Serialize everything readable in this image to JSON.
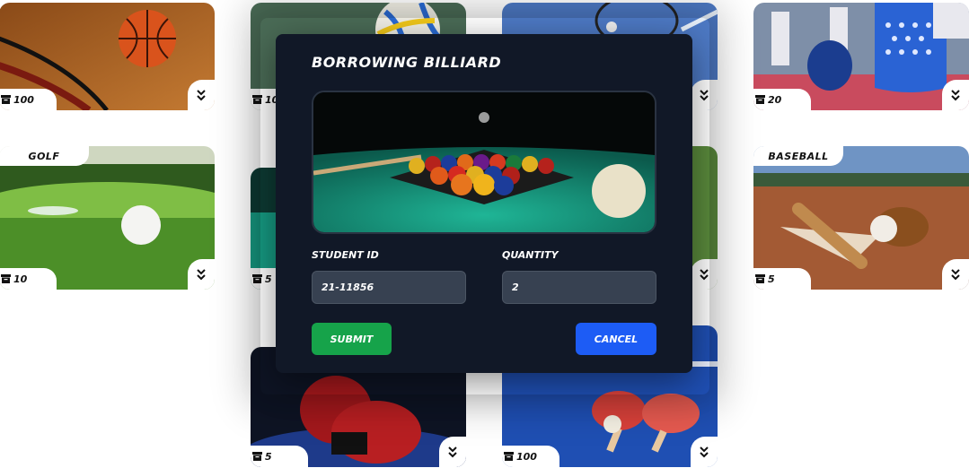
{
  "cards": [
    {
      "id": "basketball",
      "title": "",
      "qty": "100"
    },
    {
      "id": "volleyball",
      "title": "",
      "qty": "10"
    },
    {
      "id": "badminton",
      "title": "",
      "qty": ""
    },
    {
      "id": "taekwondo",
      "title": "",
      "qty": "20"
    },
    {
      "id": "golf",
      "title": "GOLF",
      "qty": "10"
    },
    {
      "id": "billiard",
      "title": "",
      "qty": "5"
    },
    {
      "id": "football",
      "title": "",
      "qty": ""
    },
    {
      "id": "baseball",
      "title": "BASEBALL",
      "qty": "5"
    },
    {
      "id": "boxing",
      "title": "",
      "qty": "5"
    },
    {
      "id": "table-tennis",
      "title": "",
      "qty": "100"
    }
  ],
  "modal": {
    "title": "BORROWING BILLIARD",
    "student_id_label": "STUDENT ID",
    "student_id_value": "21-11856",
    "quantity_label": "QUANTITY",
    "quantity_value": "2",
    "submit_label": "SUBMIT",
    "cancel_label": "CANCEL"
  },
  "colors": {
    "modal_bg": "#111827",
    "submit": "#16a34a",
    "cancel": "#1d5cf5",
    "field_bg": "#374151"
  }
}
